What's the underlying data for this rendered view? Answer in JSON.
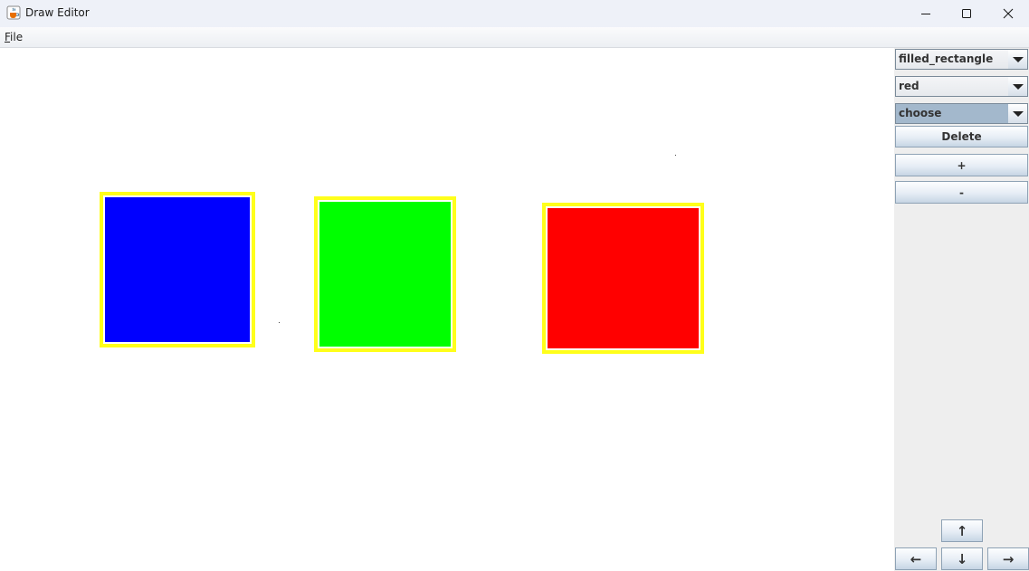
{
  "window": {
    "title": "Draw Editor"
  },
  "menubar": {
    "file_mnemonic": "F",
    "file_rest": "ile"
  },
  "canvas": {
    "shapes": [
      {
        "type": "filled_rectangle",
        "fill_color": "#0000ff",
        "selection_color": "#ffff1a"
      },
      {
        "type": "filled_rectangle",
        "fill_color": "#00ff00",
        "selection_color": "#ffff1a"
      },
      {
        "type": "filled_rectangle",
        "fill_color": "#ff0000",
        "selection_color": "#ffff1a"
      }
    ]
  },
  "sidepanel": {
    "shape_select": {
      "value": "filled_rectangle"
    },
    "color_select": {
      "value": "red"
    },
    "action_select": {
      "value": "choose"
    },
    "delete_label": "Delete",
    "plus_label": "+",
    "minus_label": "-",
    "up_label": "↑",
    "left_label": "←",
    "down_label": "↓",
    "right_label": "→"
  },
  "icons": {
    "app": "java-cup-icon",
    "minimize": "minimize-icon",
    "maximize": "maximize-icon",
    "close": "close-icon",
    "dropdown": "triangle-down-icon"
  }
}
